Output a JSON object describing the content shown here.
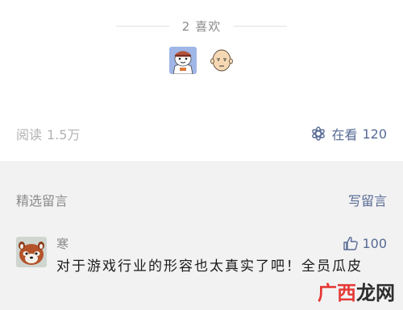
{
  "likes": {
    "count": "2",
    "label": "喜欢",
    "avatars": [
      {
        "name": "cartoon-cat-avatar"
      },
      {
        "name": "bald-hero-avatar"
      }
    ]
  },
  "stats": {
    "reads_label": "阅读",
    "reads_value": "1.5万",
    "looking_label": "在看",
    "looking_value": "120"
  },
  "comments": {
    "title": "精选留言",
    "write_label": "写留言",
    "items": [
      {
        "author": "寒",
        "likes": "100",
        "text": "对于游戏行业的形容也太真实了吧！全员瓜皮"
      }
    ]
  },
  "watermark": {
    "part1": "广西",
    "part2": "龙网"
  },
  "colors": {
    "link": "#576b95",
    "muted": "#8a8a8a",
    "background_gray": "#f2f2f2",
    "watermark_red": "#e53935"
  }
}
